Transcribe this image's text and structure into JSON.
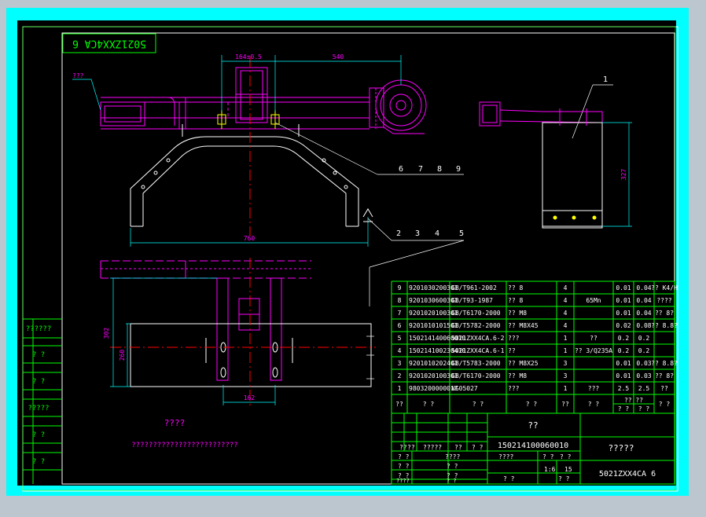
{
  "drawing": {
    "code_box": "5021ZXX4CA 6",
    "material_note": "???",
    "tech_req_title": "????",
    "tech_req_text": "?????????????????????????",
    "balloons": [
      "1",
      "2",
      "3",
      "4",
      "5",
      "6",
      "7",
      "8",
      "9"
    ],
    "dims": {
      "top_left": "164±0.5",
      "top_right": "540",
      "width_760": "760",
      "right_height": "327",
      "bottom_162": "162",
      "left_260": "260",
      "left_300": "302"
    }
  },
  "left_stamps": [
    "??????",
    "? ?",
    "? ?",
    "?????",
    "? ?",
    "? ?"
  ],
  "bom": {
    "rows": [
      {
        "no": "9",
        "code": "9201030200301",
        "std": "GB/T961-2002",
        "name": "?? 8",
        "qty": "4",
        "mat": "",
        "w1": "0.01",
        "w2": "0.04",
        "note": "?? K4/H"
      },
      {
        "no": "8",
        "code": "9201030600301",
        "std": "GB/T93-1987",
        "name": "?? 8",
        "qty": "4",
        "mat": "65Mn",
        "w1": "0.01",
        "w2": "0.04",
        "note": "????"
      },
      {
        "no": "7",
        "code": "9201020100301",
        "std": "GB/T6170-2000",
        "name": "?? M8",
        "qty": "4",
        "mat": "",
        "w1": "0.01",
        "w2": "0.04",
        "note": "?? 8?"
      },
      {
        "no": "6",
        "code": "9201010101501",
        "std": "GB/T5782-2000",
        "name": "?? M8X45",
        "qty": "4",
        "mat": "",
        "w1": "0.02",
        "w2": "0.08",
        "note": "?? 8.8?"
      },
      {
        "no": "5",
        "code": "150214140060010",
        "std": "5021ZXX4CA.6-2",
        "name": "???",
        "qty": "1",
        "mat": "??",
        "w1": "0.2",
        "w2": "0.2",
        "note": ""
      },
      {
        "no": "4",
        "code": "150214100230410",
        "std": "5021ZXX4CA.6-1",
        "name": "??",
        "qty": "1",
        "mat": "?? 3/Q235A",
        "w1": "0.2",
        "w2": "0.2",
        "note": ""
      },
      {
        "no": "3",
        "code": "9201010202401",
        "std": "GB/T5783-2000",
        "name": "?? M8X25",
        "qty": "3",
        "mat": "",
        "w1": "0.01",
        "w2": "0.03",
        "note": "?? 8.8?"
      },
      {
        "no": "2",
        "code": "9201020100301",
        "std": "GB/T6170-2000",
        "name": "?? M8",
        "qty": "3",
        "mat": "",
        "w1": "0.01",
        "w2": "0.03",
        "note": "?? 8?"
      },
      {
        "no": "1",
        "code": "9803200000017",
        "std": "NG05027",
        "name": "???",
        "qty": "1",
        "mat": "???",
        "w1": "2.5",
        "w2": "2.5",
        "note": "??"
      }
    ],
    "header": {
      "no": "??",
      "code": "?  ?",
      "std": "?  ?",
      "name": "?  ?",
      "qty": "??",
      "mat": "?  ?",
      "w1": "? ?",
      "w2": "? ?",
      "w_top": "?? ??",
      "w_bottom": "? ?",
      "note": "?  ?"
    }
  },
  "title_block": {
    "part_name": "??",
    "drawing_no": "150214100060010",
    "company": "?????",
    "model": "5021ZXX4CA 6",
    "stage_label": "????",
    "scale_label": "? ?",
    "weight_label": "? ?",
    "scale_value": "1:6",
    "sheet_value": "15",
    "sheet_label": "? ?",
    "sheets_label": "? ?",
    "rev_row": [
      "??",
      "??",
      "?????",
      "??",
      "? ?"
    ],
    "left_rows": [
      "? ?",
      "? ?",
      "? ?",
      "????"
    ],
    "mid_rows": [
      "????",
      "? ?",
      "? ?",
      "? ?"
    ]
  },
  "colors": {
    "frame_cyan": "#00ffff",
    "paper": "#000000",
    "border_green": "#00ff00",
    "part_magenta": "#ff00ff",
    "centerline_red": "#ff0000",
    "dim_cyan": "#00ffff",
    "detail_white": "#ffffff",
    "hole_yellow": "#ffff00"
  }
}
